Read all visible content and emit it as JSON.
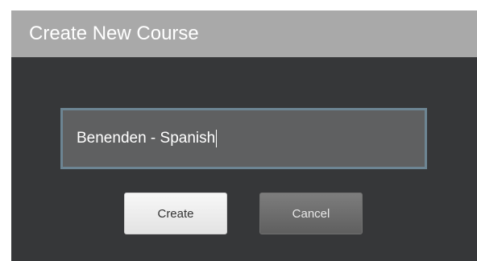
{
  "dialog": {
    "title": "Create New Course",
    "course_name_input": {
      "value": "Benenden - Spanish",
      "placeholder": ""
    },
    "buttons": {
      "create_label": "Create",
      "cancel_label": "Cancel"
    }
  },
  "colors": {
    "titlebar_bg": "#a9a9a9",
    "dialog_bg": "#363739",
    "input_bg": "#5f6061",
    "input_border": "#6d8593",
    "create_button_bg": "#efefef",
    "cancel_button_bg": "#6e6e6e"
  }
}
